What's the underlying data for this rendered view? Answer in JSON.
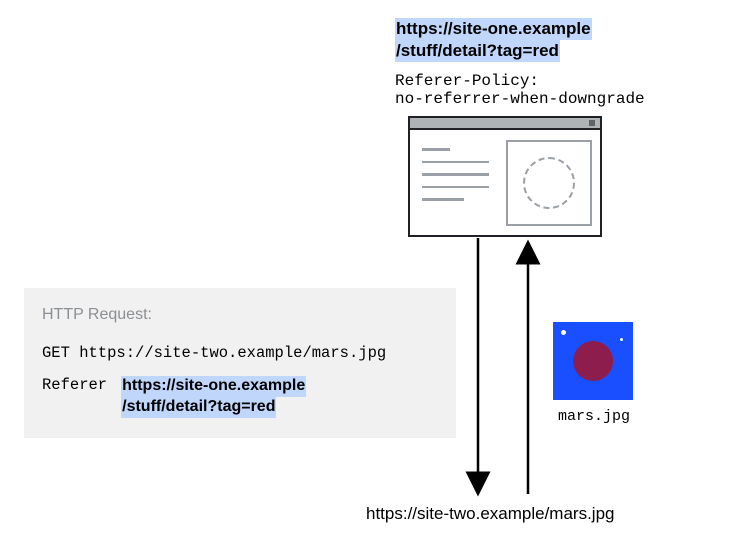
{
  "top_url_full": "https://site-one.example/stuff/detail?tag=red",
  "top_url_line1": "https://site-one.example",
  "top_url_line2": "/stuff/detail?tag=red",
  "policy_label": "Referer-Policy:",
  "policy_value": "no-referrer-when-downgrade",
  "request_title": "HTTP Request:",
  "request_method": "GET",
  "request_url": "https://site-two.example/mars.jpg",
  "referer_label": "Referer",
  "referer_line1": "https://site-one.example",
  "referer_line2": "/stuff/detail?tag=red",
  "mars_caption": "mars.jpg",
  "bottom_url": "https://site-two.example/mars.jpg"
}
